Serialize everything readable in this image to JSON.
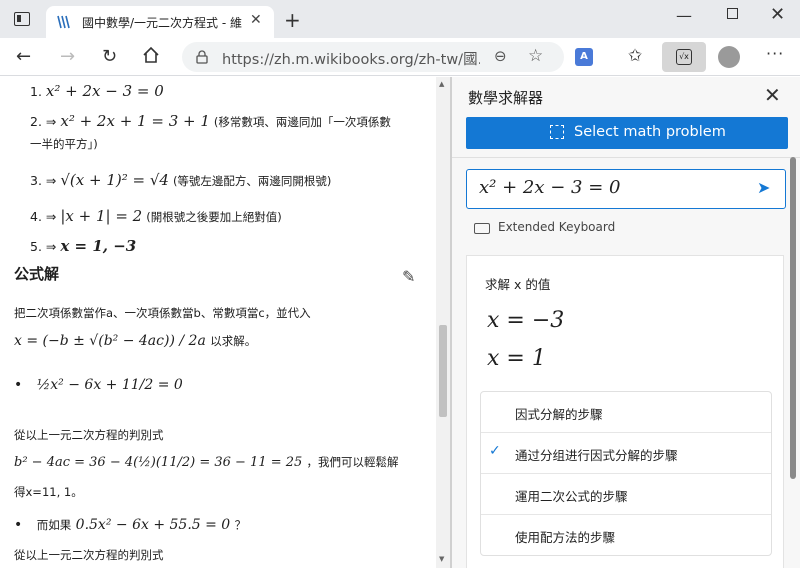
{
  "tab": {
    "title": "國中數學/一元二次方程式 - 維基"
  },
  "toolbar": {
    "url": "https://zh.m.wikibooks.org/zh-tw/國..."
  },
  "content": {
    "step1": {
      "num": "1.",
      "math": "x² + 2x − 3 = 0"
    },
    "step2": {
      "num": "2. ⇒",
      "math": "x² + 2x + 1 = 3 + 1",
      "note": "(移常數項、兩邊同加「一次項係數",
      "note2": "一半的平方」)"
    },
    "step3": {
      "num": "3. ⇒",
      "math": "√(x + 1)² = √4",
      "note": "(等號左邊配方、兩邊同開根號)"
    },
    "step4": {
      "num": "4. ⇒",
      "math": "|x + 1| = 2",
      "note": "(開根號之後要加上絕對值)"
    },
    "step5": {
      "num": "5. ⇒",
      "math": "x = 1, −3"
    },
    "heading": "公式解",
    "intro": "把二次項係數當作a、一次項係數當b、常數項當c，並代入",
    "formula": "x = (−b ± √(b² − 4ac)) / 2a",
    "formula_suffix": "以求解。",
    "bullet1": "½x² − 6x + 11/2 = 0",
    "discriminant_label": "從以上一元二次方程的判別式",
    "discriminant": "b² − 4ac = 36 − 4(½)(11/2) = 36 − 11 = 25",
    "discriminant_note": "，我們可以輕鬆解",
    "solution": "得x=11, 1。",
    "bullet2_prefix": "而如果",
    "bullet2_math": "0.5x² − 6x + 55.5 = 0",
    "bullet2_suffix": "？",
    "discriminant_label2": "從以上一元二次方程的判別式"
  },
  "panel": {
    "title": "數學求解器",
    "select_label": "Select math problem",
    "input_value": "x² + 2x − 3 = 0",
    "keyboard_label": "Extended Keyboard",
    "results_heading": "求解 x 的值",
    "answers": [
      "x = −3",
      "x = 1"
    ],
    "step_options": [
      {
        "label": "因式分解的步驟",
        "checked": false
      },
      {
        "label": "通过分组进行因式分解的步驟",
        "checked": true
      },
      {
        "label": "運用二次公式的步驟",
        "checked": false
      },
      {
        "label": "使用配方法的步驟",
        "checked": false
      }
    ]
  },
  "colors": {
    "accent": "#1478d4"
  },
  "icons": [
    "window-icon",
    "wikibooks-favicon",
    "close-icon",
    "plus-icon",
    "back-icon",
    "forward-icon",
    "reload-icon",
    "home-icon",
    "lock-icon",
    "zoom-icon",
    "favorite-add-icon",
    "translate-icon",
    "favorites-icon",
    "math-solver-icon",
    "avatar",
    "more-icon",
    "edit-icon",
    "select-region-icon",
    "send-icon",
    "keyboard-icon",
    "checkmark-icon"
  ]
}
